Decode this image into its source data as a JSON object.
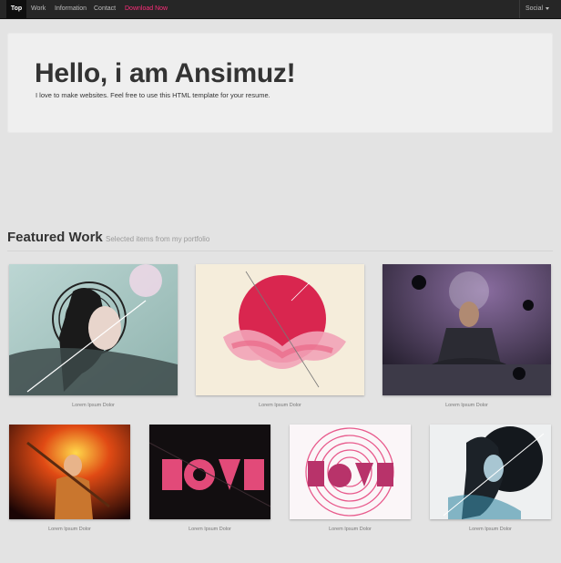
{
  "nav": {
    "items": [
      "Top",
      "Work",
      "Information",
      "Contact",
      "Download Now"
    ],
    "social_label": "Social"
  },
  "hero": {
    "title": "Hello, i am Ansimuz!",
    "subtitle": "I love to make websites. Feel free to use this HTML template for your resume."
  },
  "featured": {
    "title": "Featured Work",
    "subtitle": "Selected items from my portfolio"
  },
  "portfolio": {
    "items": [
      {
        "caption": "Lorem Ipsum Dolor"
      },
      {
        "caption": "Lorem Ipsum Dolor"
      },
      {
        "caption": "Lorem Ipsum Dolor"
      },
      {
        "caption": "Lorem Ipsum Dolor"
      },
      {
        "caption": "Lorem Ipsum Dolor"
      },
      {
        "caption": "Lorem Ipsum Dolor"
      },
      {
        "caption": "Lorem Ipsum Dolor"
      }
    ]
  },
  "colors": {
    "accent": "#ff2d7a",
    "topbar": "#262626",
    "background": "#e3e3e3"
  }
}
